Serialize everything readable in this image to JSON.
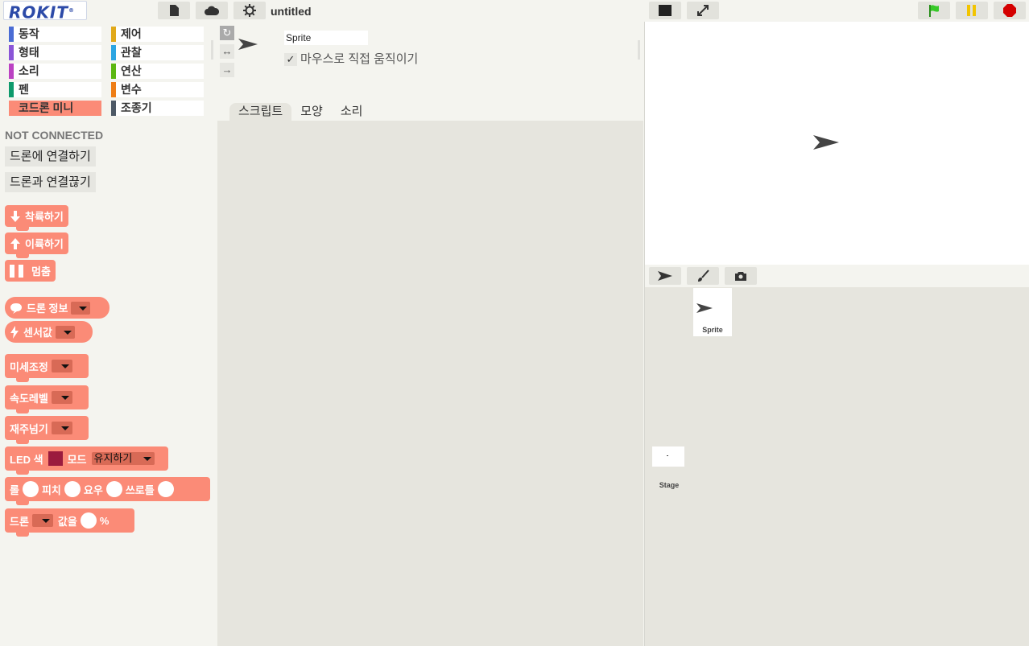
{
  "app": {
    "logo": "ROKIT",
    "logo_mark": "®",
    "project_title": "untitled"
  },
  "topbar": {
    "file_icon": "file-icon",
    "cloud_icon": "cloud-icon",
    "settings_icon": "gear-icon"
  },
  "categories": [
    {
      "label": "동작",
      "color": "#4a6cd4"
    },
    {
      "label": "제어",
      "color": "#e1a91a"
    },
    {
      "label": "형태",
      "color": "#8a55d7"
    },
    {
      "label": "관찰",
      "color": "#2ca5e2"
    },
    {
      "label": "소리",
      "color": "#bb42c3"
    },
    {
      "label": "연산",
      "color": "#5cb712"
    },
    {
      "label": "펜",
      "color": "#0e9a6c"
    },
    {
      "label": "변수",
      "color": "#ee7d16"
    },
    {
      "label": "코드론 미니",
      "color": "#fb8b77"
    },
    {
      "label": "조종기",
      "color": "#4d5966"
    }
  ],
  "palette": {
    "status": "NOT CONNECTED",
    "connect_button": "드론에 연결하기",
    "disconnect_button": "드론과 연결끊기",
    "blocks": {
      "land": "착륙하기",
      "takeoff": "이륙하기",
      "stop": "멈춤",
      "drone_info": "드론 정보",
      "sensor": "센서값",
      "trim": "미세조정",
      "speed": "속도레벨",
      "flip": "재주넘기",
      "led_prefix": "LED 색",
      "led_mode": "모드",
      "led_mode_value": "유지하기",
      "roll": "롤",
      "pitch": "피치",
      "yaw": "요우",
      "throttle": "쓰로틀",
      "drone_prefix": "드론",
      "value_label": "값을",
      "percent": "%"
    },
    "led_color": "#9b1b3e"
  },
  "sprite": {
    "name": "Sprite",
    "drag_label": "마우스로 직접 움직이기",
    "drag_checked": "✓",
    "rotation_styles": [
      "↻",
      "↔",
      "→"
    ]
  },
  "tabs": [
    {
      "label": "스크립트"
    },
    {
      "label": "모양"
    },
    {
      "label": "소리"
    }
  ],
  "stage": {
    "controls": {
      "small_stage_icon": "small-stage-icon",
      "fullscreen_icon": "fullscreen-icon",
      "green_flag_icon": "green-flag-icon",
      "pause_icon": "pause-icon",
      "stop_icon": "stop-icon"
    }
  },
  "library": {
    "new_sprite_icons": [
      "sprite-arrow-icon",
      "paintbrush-icon",
      "camera-icon"
    ],
    "sprite_label": "Sprite",
    "stage_label": "Stage"
  }
}
